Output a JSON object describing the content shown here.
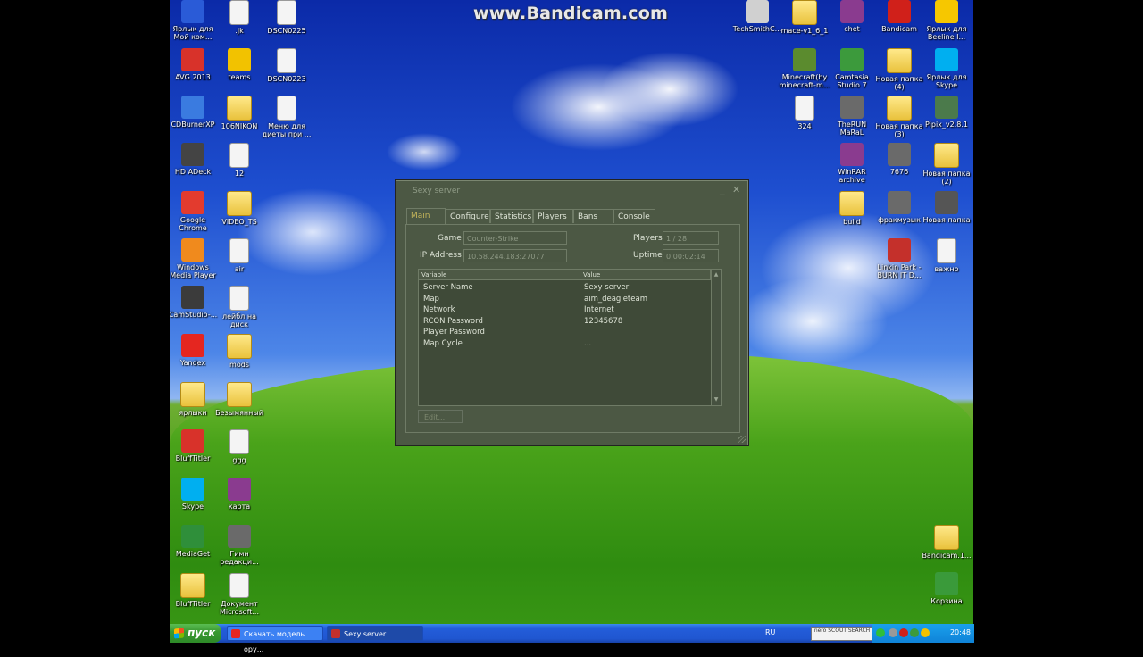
{
  "watermark": "www.Bandicam.com",
  "desktop_icons_left": [
    {
      "label": "Ярлык для Мой ком...",
      "icon": "computer-shortcut-icon",
      "color": "#2a5bd7"
    },
    {
      "label": ".jk",
      "icon": "document-icon",
      "color": "#f4f4f4"
    },
    {
      "label": "DSCN0225",
      "icon": "image-file-icon",
      "color": "#f4f4f4"
    },
    {
      "label": "AVG 2013",
      "icon": "avg-icon",
      "color": "#d8322a"
    },
    {
      "label": "teams",
      "icon": "teams-icon",
      "color": "#f2c200"
    },
    {
      "label": "DSCN0223",
      "icon": "image-file-icon",
      "color": "#f4f4f4"
    },
    {
      "label": "CDBurnerXP",
      "icon": "cdburner-icon",
      "color": "#3a7be0"
    },
    {
      "label": "106NIKON",
      "icon": "folder-icon",
      "color": "#f2cf4f"
    },
    {
      "label": "Меню для диеты при ...",
      "icon": "word-document-icon",
      "color": "#f4f4f4"
    },
    {
      "label": "HD ADeck",
      "icon": "hdadeck-icon",
      "color": "#444444"
    },
    {
      "label": "12",
      "icon": "image-file-icon",
      "color": "#f4f4f4"
    },
    {
      "label": "Google Chrome",
      "icon": "chrome-icon",
      "color": "#e33b2e"
    },
    {
      "label": "VIDEO_TS",
      "icon": "folder-icon",
      "color": "#f2cf4f"
    },
    {
      "label": "Windows Media Player",
      "icon": "media-player-icon",
      "color": "#f08a1d"
    },
    {
      "label": "air",
      "icon": "document-icon",
      "color": "#f4f4f4"
    },
    {
      "label": "CamStudio-...",
      "icon": "camstudio-icon",
      "color": "#3b3b3b"
    },
    {
      "label": "лейбл на диск",
      "icon": "image-file-icon",
      "color": "#f4f4f4"
    },
    {
      "label": "Yandex",
      "icon": "yandex-icon",
      "color": "#e52620"
    },
    {
      "label": "mods",
      "icon": "folder-icon",
      "color": "#f2cf4f"
    },
    {
      "label": "ярлыки",
      "icon": "folder-icon",
      "color": "#f2cf4f"
    },
    {
      "label": "Безымянный",
      "icon": "folder-icon",
      "color": "#f2cf4f"
    },
    {
      "label": "BluffTitler",
      "icon": "blufftitler-icon",
      "color": "#d8322a"
    },
    {
      "label": "ggg",
      "icon": "image-file-icon",
      "color": "#f4f4f4"
    },
    {
      "label": "Skype",
      "icon": "skype-icon",
      "color": "#00aff0"
    },
    {
      "label": "карта",
      "icon": "winrar-icon",
      "color": "#8a3b8f"
    },
    {
      "label": "MediaGet",
      "icon": "mediaget-icon",
      "color": "#2f8f3a"
    },
    {
      "label": "Гимн редакци...",
      "icon": "mpg-file-icon",
      "color": "#6a6a6a"
    },
    {
      "label": "BluffTitler",
      "icon": "folder-icon",
      "color": "#f2cf4f"
    },
    {
      "label": "Документ Microsoft...",
      "icon": "word-document-icon",
      "color": "#f4f4f4"
    }
  ],
  "desktop_icons_right": [
    {
      "label": "TechSmithC...",
      "icon": "installer-icon",
      "color": "#d0d0d0"
    },
    {
      "label": "mace-v1_6_1",
      "icon": "folder-icon",
      "color": "#f2cf4f"
    },
    {
      "label": "chet",
      "icon": "winrar-icon",
      "color": "#8a3b8f"
    },
    {
      "label": "Bandicam",
      "icon": "bandicam-icon",
      "color": "#d0201a"
    },
    {
      "label": "Ярлык для Beeline I...",
      "icon": "beeline-icon",
      "color": "#f6c700"
    },
    {
      "label": "Minecraft(by minecraft-m...",
      "icon": "minecraft-icon",
      "color": "#5b8b2e"
    },
    {
      "label": "Camtasia Studio 7",
      "icon": "camtasia-icon",
      "color": "#3c9a3c"
    },
    {
      "label": "Новая папка (4)",
      "icon": "folder-icon",
      "color": "#f2cf4f"
    },
    {
      "label": "Ярлык для Skype",
      "icon": "skype-icon",
      "color": "#00aff0"
    },
    {
      "label": "324",
      "icon": "document-icon",
      "color": "#f4f4f4"
    },
    {
      "label": "TheRUN MaRaL",
      "icon": "avi-file-icon",
      "color": "#6a6a6a"
    },
    {
      "label": "Новая папка (3)",
      "icon": "folder-icon",
      "color": "#f2cf4f"
    },
    {
      "label": "Pipix_v2.8.1",
      "icon": "pipix-icon",
      "color": "#4b7a4b"
    },
    {
      "label": "WinRAR archive",
      "icon": "winrar-icon",
      "color": "#8a3b8f"
    },
    {
      "label": "7676",
      "icon": "avi-file-icon",
      "color": "#6a6a6a"
    },
    {
      "label": "Новая папка (2)",
      "icon": "folder-icon",
      "color": "#f2cf4f"
    },
    {
      "label": "build",
      "icon": "folder-icon",
      "color": "#f2cf4f"
    },
    {
      "label": "фракмузык",
      "icon": "avi-file-icon",
      "color": "#6a6a6a"
    },
    {
      "label": "Новая папка",
      "icon": "usb-drive-icon",
      "color": "#555555"
    },
    {
      "label": "Linkin Park - BURN IT D...",
      "icon": "mp3-file-icon",
      "color": "#c4302b"
    },
    {
      "label": "важно",
      "icon": "document-icon",
      "color": "#f4f4f4"
    },
    {
      "label": "Bandicam.1...",
      "icon": "folder-icon",
      "color": "#f2cf4f"
    },
    {
      "label": "Корзина",
      "icon": "recycle-bin-icon",
      "color": "#3a9a3a"
    }
  ],
  "dialog": {
    "title": "Sexy server",
    "minimize": "_",
    "close": "✕",
    "tabs": [
      "Main",
      "Configure",
      "Statistics",
      "Players",
      "Bans",
      "Console"
    ],
    "active_tab": "Main",
    "fields": {
      "game_label": "Game",
      "game_value": "Counter-Strike",
      "players_label": "Players",
      "players_value": "1 / 28",
      "ip_label": "IP Address",
      "ip_value": "10.58.244.183:27077",
      "uptime_label": "Uptime",
      "uptime_value": "0:00:02:14"
    },
    "table": {
      "headers": [
        "Variable",
        "Value"
      ],
      "rows": [
        [
          "Server Name",
          "Sexy server"
        ],
        [
          "Map",
          "aim_deagleteam"
        ],
        [
          "Network",
          "Internet"
        ],
        [
          "RCON Password",
          "12345678"
        ],
        [
          "Player Password",
          ""
        ],
        [
          "Map Cycle",
          "..."
        ]
      ]
    },
    "edit_button": "Edit..."
  },
  "taskbar": {
    "start_label": "пуск",
    "buttons": [
      {
        "label": "Скачать модель ору...",
        "icon": "yandex-icon",
        "color": "#e52620"
      },
      {
        "label": "Sexy server",
        "icon": "server-icon",
        "color": "#c4302b"
      }
    ],
    "language": "RU",
    "nero_label": "nero SCOUT SEARCH",
    "clock": "20:48"
  }
}
